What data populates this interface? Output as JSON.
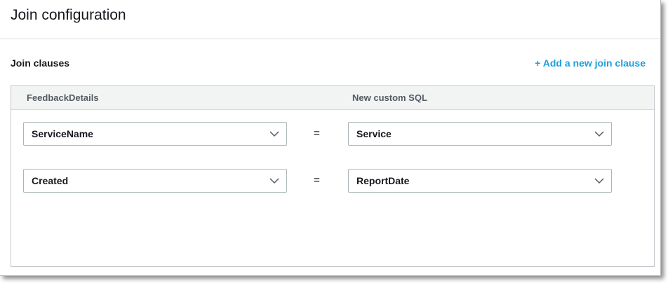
{
  "header": {
    "title": "Join configuration"
  },
  "join_clauses": {
    "label": "Join clauses",
    "add_link": "+ Add a new join clause",
    "left_table": "FeedbackDetails",
    "right_table": "New custom SQL",
    "operator": "=",
    "rows": [
      {
        "left": "ServiceName",
        "right": "Service"
      },
      {
        "left": "Created",
        "right": "ReportDate"
      }
    ]
  }
}
